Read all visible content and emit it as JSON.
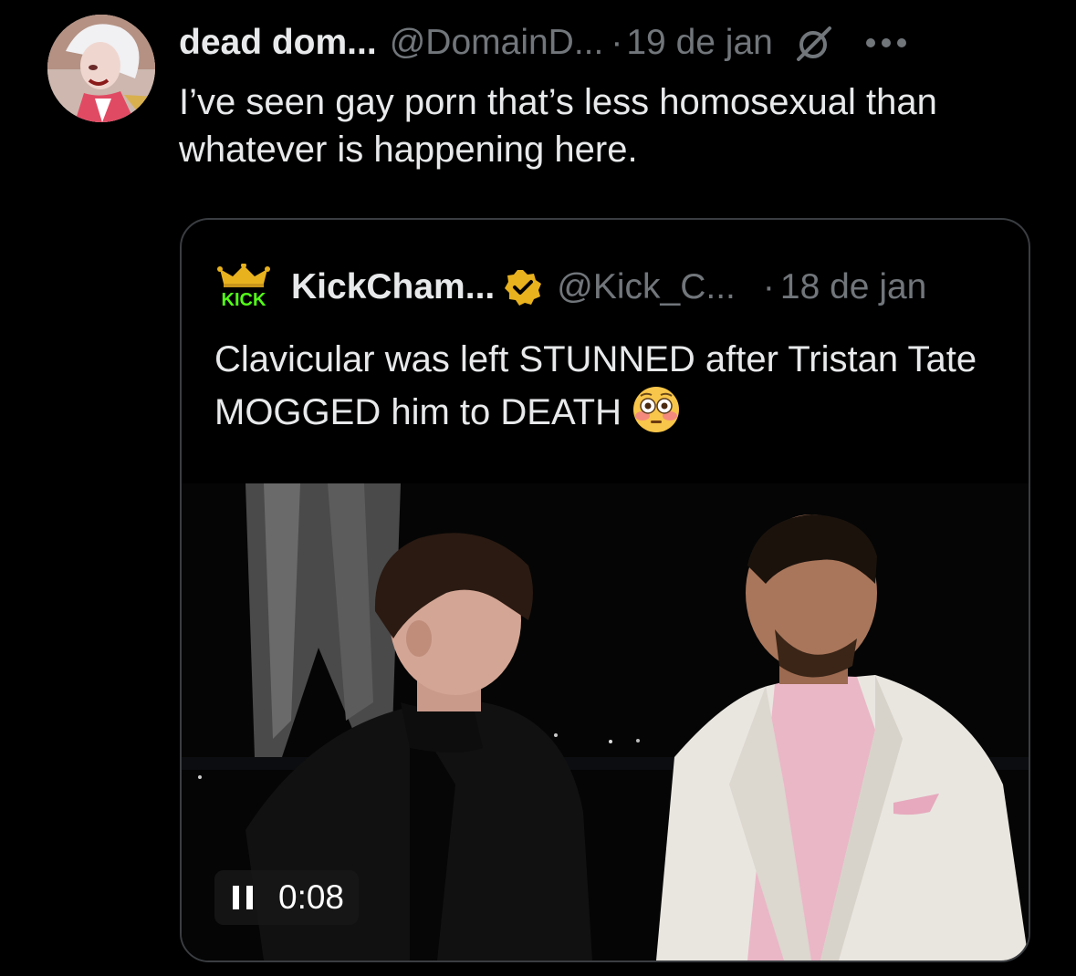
{
  "tweet": {
    "display_name": "dead dom...",
    "handle": "@DomainD...",
    "separator": "·",
    "date": "19 de jan",
    "text": "I’ve seen gay porn that’s less homosexual than whatever is happening here.",
    "icons": [
      "avatar",
      "nosign-icon",
      "more-icon"
    ]
  },
  "quoted": {
    "display_name": "KickCham...",
    "handle": "@Kick_C...",
    "separator": "·",
    "date": "18 de jan",
    "verified": true,
    "text": "Clavicular was left STUNNED after Tristan Tate MOGGED him to DEATH",
    "emoji": "flushed-face-icon",
    "avatar_logo_text": "KICK",
    "video": {
      "time": "0:08",
      "state": "playing",
      "control_icon": "pause-icon"
    }
  },
  "colors": {
    "background": "#000000",
    "primary_text": "#e7e9ea",
    "secondary_text": "#71767b",
    "card_border": "#3a3d41",
    "verified_badge": "#e8b21f",
    "kick_green": "#53fc18"
  }
}
